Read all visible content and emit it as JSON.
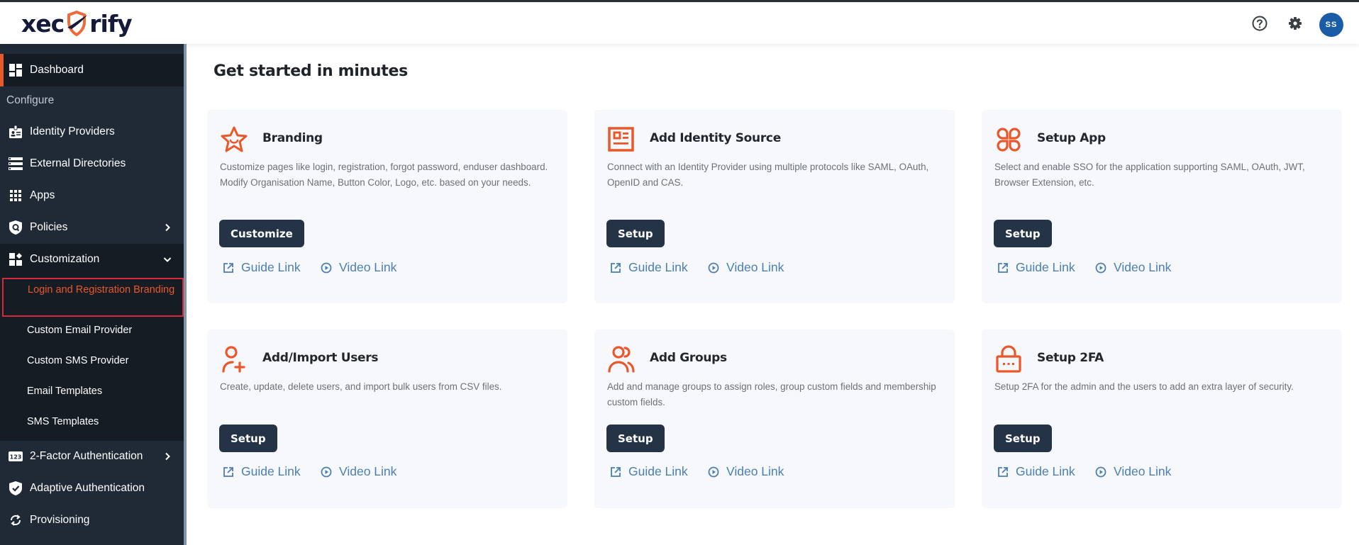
{
  "header": {
    "logo_text_left": "xec",
    "logo_text_right": "rify",
    "help_icon": "question-circle-icon",
    "settings_icon": "gear-icon",
    "avatar_initials": "SS"
  },
  "colors": {
    "accent": "#e9572a",
    "sidebar_bg": "#1f2a36",
    "button_bg": "#243446",
    "link": "#4a7fb1",
    "avatar_bg": "#1a5ca8",
    "selection_outline": "#d9283a"
  },
  "sidebar": {
    "dashboard": {
      "label": "Dashboard",
      "icon": "dashboard-icon"
    },
    "section_label": "Configure",
    "items": [
      {
        "label": "Identity Providers",
        "icon": "id-badge-icon"
      },
      {
        "label": "External Directories",
        "icon": "directory-list-icon"
      },
      {
        "label": "Apps",
        "icon": "apps-grid-icon"
      },
      {
        "label": "Policies",
        "icon": "policy-shield-icon",
        "chevron": "chevron-right-icon"
      },
      {
        "label": "Customization",
        "icon": "widgets-icon",
        "chevron": "chevron-down-icon"
      }
    ],
    "submenu": [
      {
        "label": "Login and Registration Branding",
        "selected": true
      },
      {
        "label": "Custom Email Provider"
      },
      {
        "label": "Custom SMS Provider"
      },
      {
        "label": "Email Templates"
      },
      {
        "label": "SMS Templates"
      }
    ],
    "items_after": [
      {
        "label": "2-Factor Authentication",
        "icon": "numeric-123-icon",
        "chevron": "chevron-right-icon"
      },
      {
        "label": "Adaptive Authentication",
        "icon": "shield-check-icon"
      },
      {
        "label": "Provisioning",
        "icon": "sync-icon"
      }
    ]
  },
  "main": {
    "title": "Get started in minutes",
    "guide_label": "Guide Link",
    "video_label": "Video Link",
    "cards": [
      {
        "title": "Branding",
        "icon": "star-smile-icon",
        "description": "Customize pages like login, registration, forgot password, enduser dashboard. Modify Organisation Name, Button Color, Logo, etc. based on your needs.",
        "button": "Customize"
      },
      {
        "title": "Add Identity Source",
        "icon": "id-card-icon",
        "description": "Connect with an Identity Provider using multiple protocols like SAML, OAuth, OpenID and CAS.",
        "button": "Setup"
      },
      {
        "title": "Setup App",
        "icon": "app-clover-icon",
        "description": "Select and enable SSO for the application supporting SAML, OAuth, JWT, Browser Extension, etc.",
        "button": "Setup"
      },
      {
        "title": "Add/Import Users",
        "icon": "user-add-icon",
        "description": "Create, update, delete users, and import bulk users from CSV files.",
        "button": "Setup"
      },
      {
        "title": "Add Groups",
        "icon": "users-group-icon",
        "description": "Add and manage groups to assign roles, group custom fields and membership custom fields.",
        "button": "Setup"
      },
      {
        "title": "Setup 2FA",
        "icon": "lock-dots-icon",
        "description": "Setup 2FA for the admin and the users to add an extra layer of security.",
        "button": "Setup"
      }
    ]
  }
}
